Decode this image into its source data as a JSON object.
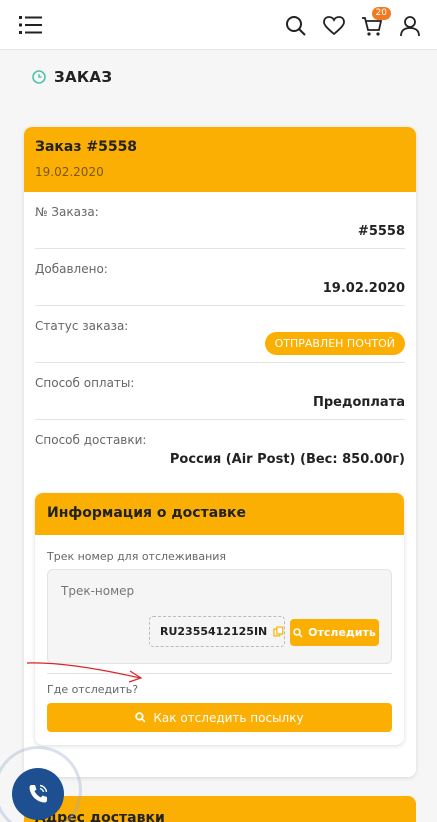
{
  "header": {
    "cart_count": "20"
  },
  "page": {
    "title": "ЗАКАЗ"
  },
  "order": {
    "title": "Заказ #5558",
    "date": "19.02.2020",
    "rows": [
      {
        "label": "№ Заказа:",
        "value": "#5558"
      },
      {
        "label": "Добавлено:",
        "value": "19.02.2020"
      },
      {
        "label": "Статус заказа:",
        "value": "ОТПРАВЛЕН ПОЧТОЙ"
      },
      {
        "label": "Способ оплаты:",
        "value": "Предоплата"
      },
      {
        "label": "Способ доставки:",
        "value": "Россия (Air Post) (Вес: 850.00г)"
      }
    ]
  },
  "delivery": {
    "title": "Информация о доставке",
    "track_label": "Трек номер для отслеживания",
    "track_box_title": "Трек-номер",
    "track_code": "RU2355412125IN",
    "track_button": "Отследить",
    "where_label": "Где отследить?",
    "how_button": "Как отследить посылку"
  },
  "next_section": {
    "title": "Адрес доставки"
  },
  "colors": {
    "accent": "#fcaf03",
    "phone_button": "#1d4f91",
    "badge": "#f07a22"
  }
}
